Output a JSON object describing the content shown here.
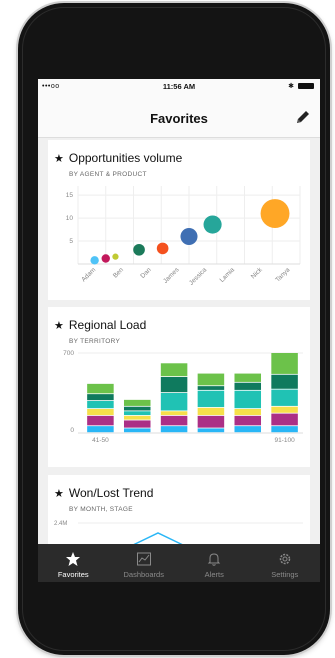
{
  "status_bar": {
    "carrier": "•••oo",
    "time": "11:56 AM",
    "bluetooth": "✱"
  },
  "nav": {
    "title": "Favorites",
    "edit_icon": "pencil-icon"
  },
  "cards": {
    "opportunities": {
      "title": "Opportunities volume",
      "subtitle": "BY AGENT & PRODUCT",
      "y_ticks": [
        "15",
        "10",
        "5"
      ],
      "x_labels": [
        "Adam",
        "Ben",
        "Dan",
        "James",
        "Jessica",
        "Lamia",
        "Nick",
        "Tanya"
      ]
    },
    "regional": {
      "title": "Regional Load",
      "subtitle": "BY TERRITORY",
      "y_ticks": [
        "700",
        "0"
      ],
      "x_labels": [
        "41-50",
        "91-100"
      ]
    },
    "wonlost": {
      "title": "Won/Lost Trend",
      "subtitle": "BY MONTH, STAGE",
      "y_ticks": [
        "2.4M"
      ]
    }
  },
  "chart_data": [
    {
      "type": "scatter",
      "title": "Opportunities volume",
      "subtitle": "BY AGENT & PRODUCT",
      "categories": [
        "Adam",
        "Ben",
        "Dan",
        "James",
        "Jessica",
        "Lamia",
        "Nick",
        "Tanya"
      ],
      "ylim": [
        0,
        17
      ],
      "points": [
        {
          "x": 0.1,
          "y": 0.8,
          "size": 1,
          "color": "#4fc3f7"
        },
        {
          "x": 0.5,
          "y": 1.2,
          "size": 1,
          "color": "#c2185b"
        },
        {
          "x": 0.85,
          "y": 1.6,
          "size": 0.6,
          "color": "#c0ca33"
        },
        {
          "x": 1.7,
          "y": 3.1,
          "size": 1.6,
          "color": "#1b7a5a"
        },
        {
          "x": 2.55,
          "y": 3.4,
          "size": 1.6,
          "color": "#f4511e"
        },
        {
          "x": 3.5,
          "y": 6.0,
          "size": 2.6,
          "color": "#3f6fb3"
        },
        {
          "x": 4.35,
          "y": 8.6,
          "size": 2.8,
          "color": "#26a69a"
        },
        {
          "x": 6.6,
          "y": 11.0,
          "size": 4.8,
          "color": "#ffa726"
        }
      ]
    },
    {
      "type": "bar",
      "title": "Regional Load",
      "subtitle": "BY TERRITORY",
      "categories": [
        "41-50",
        "",
        "",
        "",
        "",
        "91-100"
      ],
      "ylim": [
        0,
        700
      ],
      "stacked": true,
      "series": [
        {
          "color": "#29b6f6",
          "values": [
            60,
            40,
            60,
            40,
            60,
            60
          ]
        },
        {
          "color": "#ab2f86",
          "values": [
            90,
            70,
            90,
            110,
            90,
            110
          ]
        },
        {
          "color": "#f6e04b",
          "values": [
            60,
            40,
            40,
            70,
            60,
            60
          ]
        },
        {
          "color": "#20c2b4",
          "values": [
            70,
            40,
            160,
            150,
            160,
            150
          ]
        },
        {
          "color": "#0f7a5e",
          "values": [
            60,
            40,
            140,
            40,
            70,
            130
          ]
        },
        {
          "color": "#6cc24a",
          "values": [
            90,
            60,
            120,
            110,
            80,
            190
          ]
        }
      ]
    },
    {
      "type": "line",
      "title": "Won/Lost Trend",
      "subtitle": "BY MONTH, STAGE",
      "yticks": [
        "2.4M"
      ]
    }
  ],
  "tabs": [
    {
      "label": "Favorites",
      "icon": "star-icon",
      "active": true
    },
    {
      "label": "Dashboards",
      "icon": "dashboard-icon",
      "active": false
    },
    {
      "label": "Alerts",
      "icon": "bell-icon",
      "active": false
    },
    {
      "label": "Settings",
      "icon": "gear-icon",
      "active": false
    }
  ]
}
